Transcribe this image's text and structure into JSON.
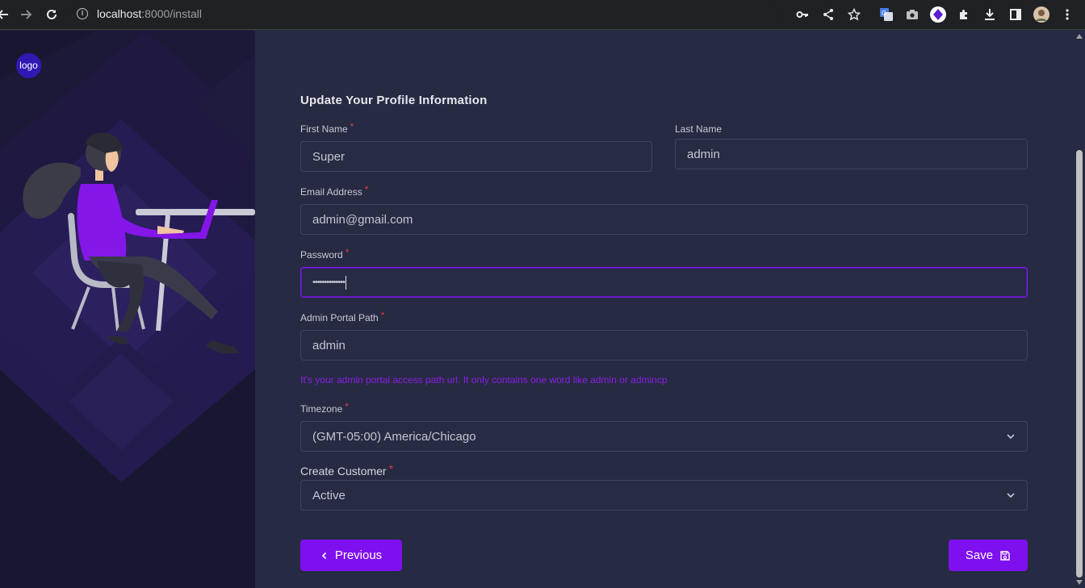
{
  "browser": {
    "url_host": "localhost",
    "url_rest": ":8000/install"
  },
  "sidebar": {
    "logo_text": "logo"
  },
  "form": {
    "title": "Update Your Profile Information",
    "first_name": {
      "label": "First Name",
      "required": "*",
      "value": "Super"
    },
    "last_name": {
      "label": "Last Name",
      "value": "admin"
    },
    "email": {
      "label": "Email Address",
      "required": "*",
      "value": "admin@gmail.com"
    },
    "password": {
      "label": "Password",
      "required": "*",
      "value": "••••••••••••••"
    },
    "admin_path": {
      "label": "Admin Portal Path",
      "required": "*",
      "value": "admin",
      "hint": "It's your admin portal access path url. It only contains one word like admin or admincp"
    },
    "timezone": {
      "label": "Timezone",
      "required": "*",
      "value": "(GMT-05:00) America/Chicago"
    },
    "create_customer": {
      "label": "Create Customer",
      "required": "*",
      "value": "Active"
    }
  },
  "buttons": {
    "previous": "Previous",
    "save": "Save"
  },
  "colors": {
    "accent": "#7e10f0",
    "required": "#e03a4b",
    "panel_bg": "#262a42",
    "sidebar_bg": "#171731"
  }
}
